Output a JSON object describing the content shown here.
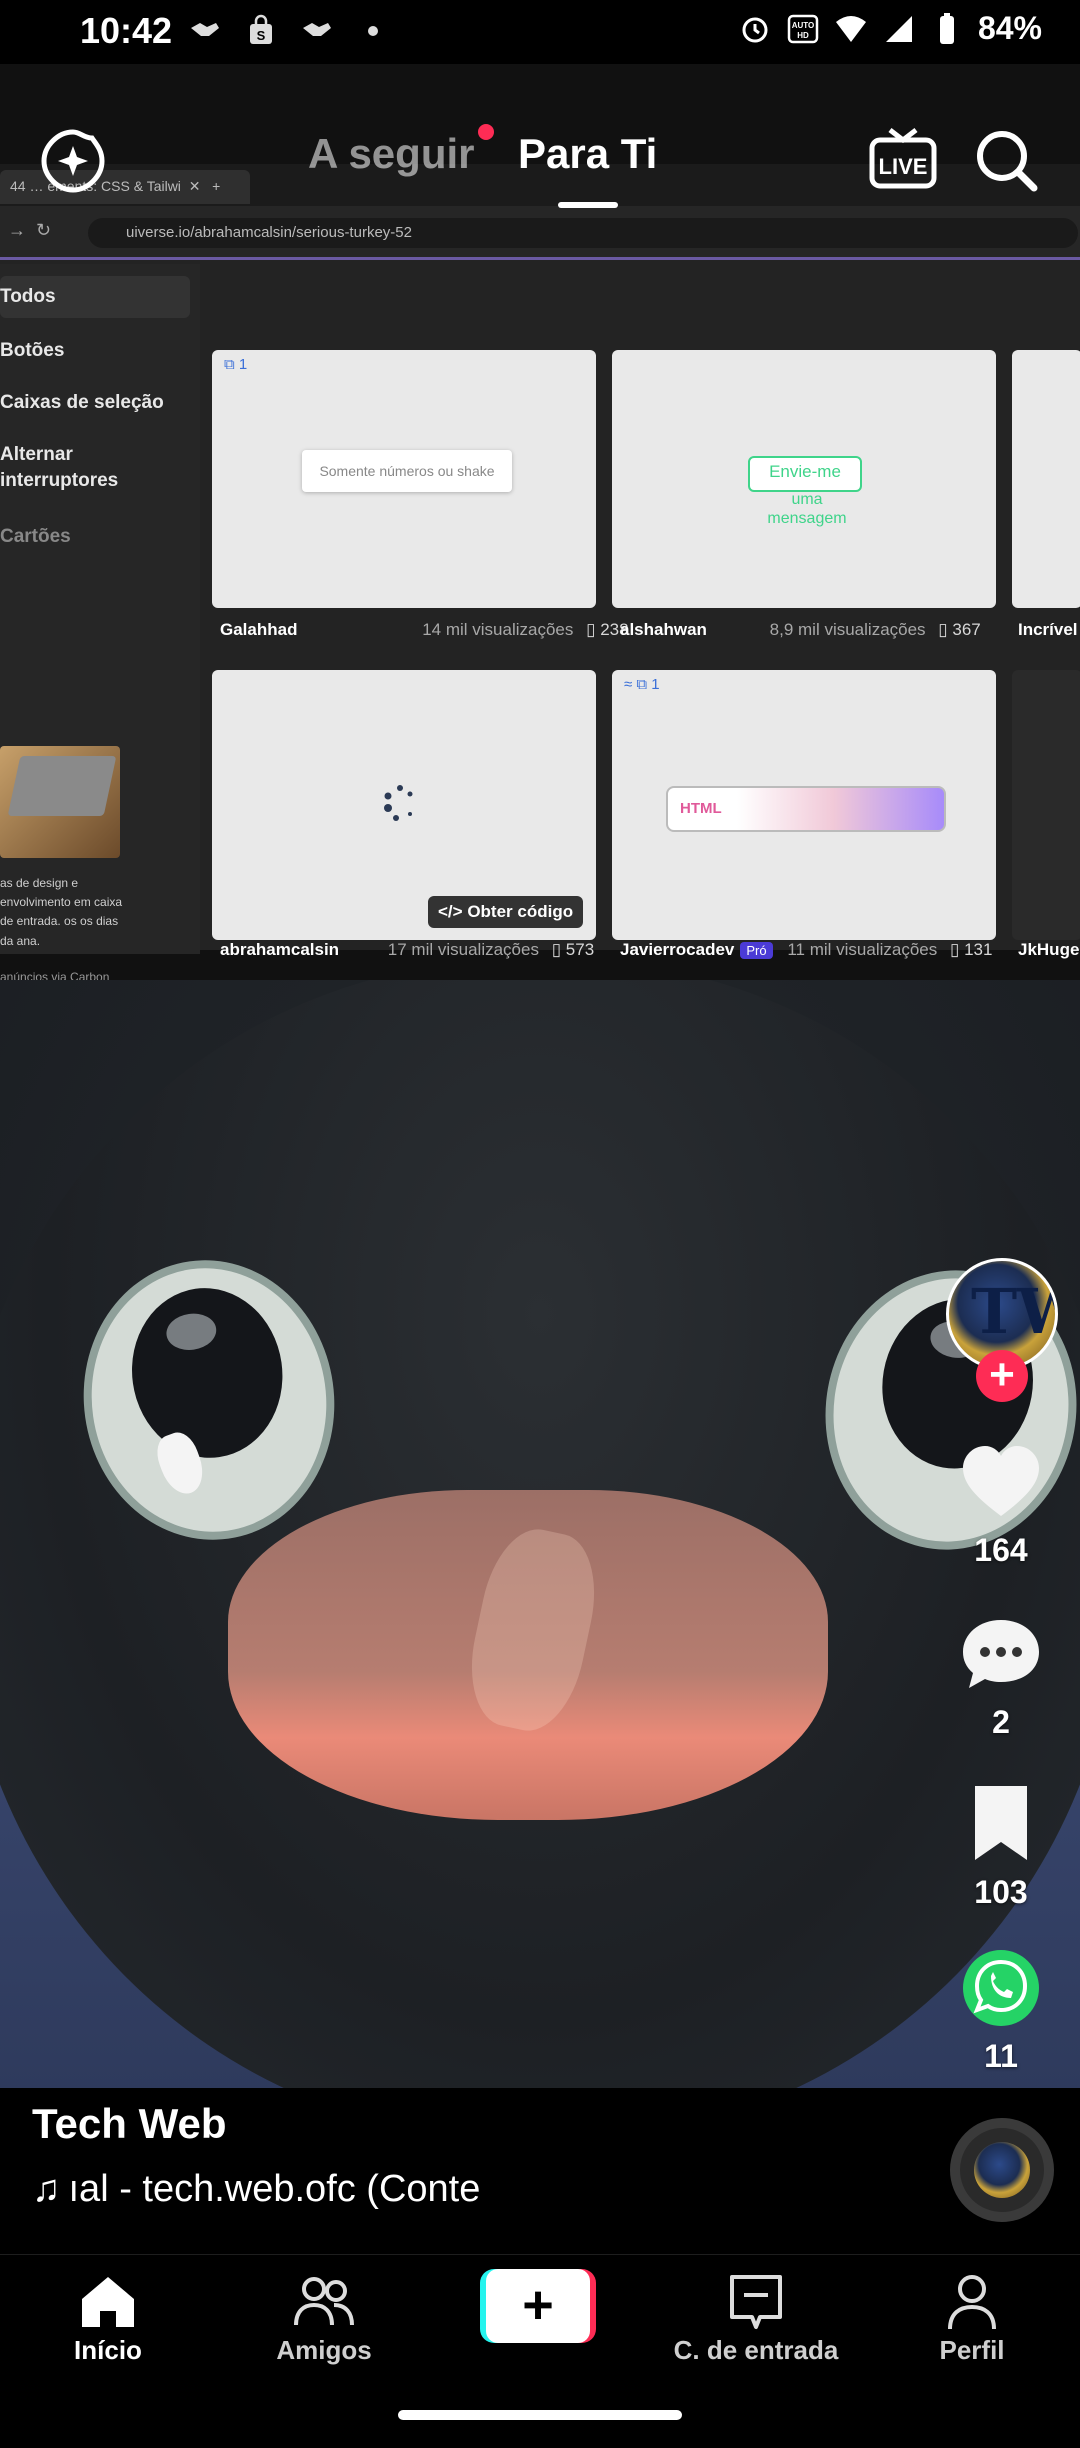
{
  "status_bar": {
    "time": "10:42",
    "battery": "84%",
    "notification_icons": [
      "handshake-icon",
      "shopping-bag-icon",
      "handshake-icon",
      "dot-icon"
    ],
    "system_icons": [
      "alarm-icon",
      "volte-icon",
      "wifi-icon",
      "signal-icon",
      "battery-icon"
    ]
  },
  "top_nav": {
    "following_label": "A seguir",
    "for_you_label": "Para Ti",
    "live_label": "LIVE"
  },
  "recording": {
    "tab_title": "44 … ements: CSS & Tailwi",
    "url": "uiverse.io/abrahamcalsin/serious-turkey-52",
    "sidebar": [
      "Todos",
      "Botões",
      "Caixas de seleção",
      "Alternar interruptores",
      "Cartões"
    ],
    "ad_text": "as de design e envolvimento em caixa de entrada. os os dias da ana.",
    "ad_footer": "anúncios via Carbon",
    "cards": [
      {
        "author": "Galahhad",
        "views": "14 mil visualizações",
        "saves": "238",
        "demo": "Somente números ou shake",
        "badge": "1"
      },
      {
        "author": "alshahwan",
        "views": "8,9 mil visualizações",
        "saves": "367",
        "demo_line1": "Envie-me",
        "demo_line2": "uma mensagem"
      },
      {
        "author": "Incrível",
        "views": "",
        "saves": ""
      },
      {
        "author": "abrahamcalsin",
        "views": "17 mil visualizações",
        "saves": "573",
        "button": "Obter código"
      },
      {
        "author": "Javierrocadev",
        "pro": "Pró",
        "views": "11 mil visualizações",
        "saves": "131",
        "demo": "HTML",
        "badge": "1"
      },
      {
        "author": "JkHuge",
        "views": "",
        "saves": ""
      }
    ]
  },
  "actions": {
    "likes": "164",
    "comments": "2",
    "saves": "103",
    "shares": "11"
  },
  "caption": {
    "username": "Tech Web",
    "music": "ıal - tech.web.ofc (Conte"
  },
  "bottom_nav": {
    "home": "Início",
    "friends": "Amigos",
    "inbox": "C. de entrada",
    "profile": "Perfil"
  }
}
